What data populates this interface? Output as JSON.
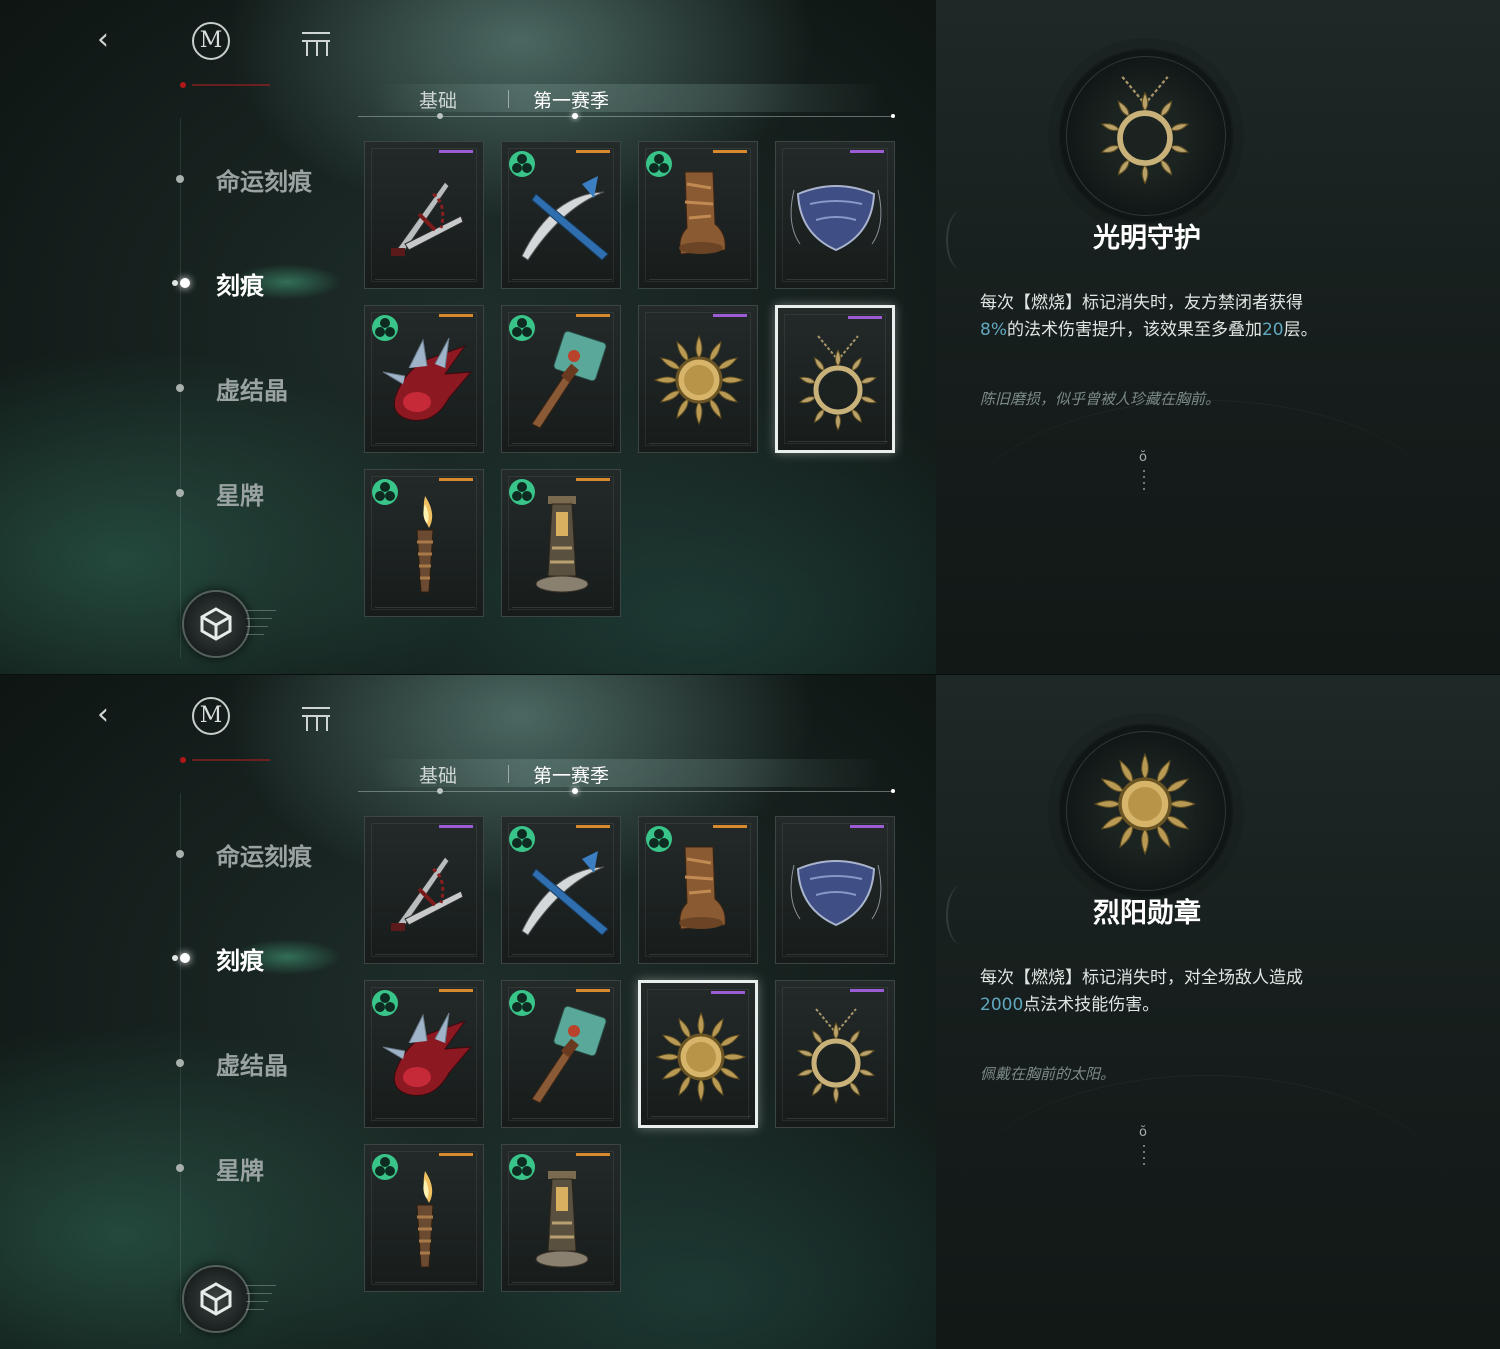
{
  "screens": [
    {
      "nav": {
        "back_icon": "chevron-left-icon",
        "logo": "M",
        "menu_icon": "menu-icon",
        "cube_icon": "cube-icon"
      },
      "sidebar": {
        "items": [
          {
            "label": "命运刻痕",
            "active": false
          },
          {
            "label": "刻痕",
            "active": true
          },
          {
            "label": "虚结晶",
            "active": false
          },
          {
            "label": "星牌",
            "active": false
          }
        ]
      },
      "tabs": [
        {
          "label": "基础",
          "active": false
        },
        {
          "label": "第一赛季",
          "active": true
        }
      ],
      "cards": [
        {
          "item": "twin-blades",
          "rarity": "purple",
          "badge": false,
          "selected": false
        },
        {
          "item": "crossed-blades",
          "rarity": "orange",
          "badge": true,
          "selected": false
        },
        {
          "item": "wooden-boot",
          "rarity": "orange",
          "badge": true,
          "selected": false
        },
        {
          "item": "silver-mask",
          "rarity": "purple",
          "badge": false,
          "selected": false
        },
        {
          "item": "red-crystal",
          "rarity": "orange",
          "badge": true,
          "selected": false
        },
        {
          "item": "stone-hammer",
          "rarity": "orange",
          "badge": true,
          "selected": false
        },
        {
          "item": "sun-medal",
          "rarity": "purple",
          "badge": false,
          "selected": false
        },
        {
          "item": "sun-necklace",
          "rarity": "purple",
          "badge": false,
          "selected": true
        },
        {
          "item": "torch",
          "rarity": "orange",
          "badge": true,
          "selected": false
        },
        {
          "item": "lantern-pillar",
          "rarity": "orange",
          "badge": true,
          "selected": false
        }
      ],
      "detail": {
        "item": "sun-necklace",
        "title": "光明守护",
        "desc": [
          {
            "text": "每次【燃烧】标记消失时，友方禁闭者获得",
            "hl": false
          },
          {
            "text": "8%",
            "hl": true
          },
          {
            "text": "的法术伤害提升，该效果至多叠加",
            "hl": false
          },
          {
            "text": "20",
            "hl": true
          },
          {
            "text": "层。",
            "hl": false
          }
        ],
        "flavor": "陈旧磨损，似乎曾被人珍藏在胸前。"
      }
    },
    {
      "nav": {
        "back_icon": "chevron-left-icon",
        "logo": "M",
        "menu_icon": "menu-icon",
        "cube_icon": "cube-icon"
      },
      "sidebar": {
        "items": [
          {
            "label": "命运刻痕",
            "active": false
          },
          {
            "label": "刻痕",
            "active": true
          },
          {
            "label": "虚结晶",
            "active": false
          },
          {
            "label": "星牌",
            "active": false
          }
        ]
      },
      "tabs": [
        {
          "label": "基础",
          "active": false
        },
        {
          "label": "第一赛季",
          "active": true
        }
      ],
      "cards": [
        {
          "item": "twin-blades",
          "rarity": "purple",
          "badge": false,
          "selected": false
        },
        {
          "item": "crossed-blades",
          "rarity": "orange",
          "badge": true,
          "selected": false
        },
        {
          "item": "wooden-boot",
          "rarity": "orange",
          "badge": true,
          "selected": false
        },
        {
          "item": "silver-mask",
          "rarity": "purple",
          "badge": false,
          "selected": false
        },
        {
          "item": "red-crystal",
          "rarity": "orange",
          "badge": true,
          "selected": false
        },
        {
          "item": "stone-hammer",
          "rarity": "orange",
          "badge": true,
          "selected": false
        },
        {
          "item": "sun-medal",
          "rarity": "purple",
          "badge": false,
          "selected": true
        },
        {
          "item": "sun-necklace",
          "rarity": "purple",
          "badge": false,
          "selected": false
        },
        {
          "item": "torch",
          "rarity": "orange",
          "badge": true,
          "selected": false
        },
        {
          "item": "lantern-pillar",
          "rarity": "orange",
          "badge": true,
          "selected": false
        }
      ],
      "detail": {
        "item": "sun-medal",
        "title": "烈阳勋章",
        "desc": [
          {
            "text": "每次【燃烧】标记消失时，对全场敌人造成",
            "hl": false
          },
          {
            "text": "2000",
            "hl": true
          },
          {
            "text": "点法术技能伤害。",
            "hl": false
          }
        ],
        "flavor": "佩戴在胸前的太阳。"
      }
    }
  ],
  "colors": {
    "highlight": "#5fa8bf",
    "badge": "#39c48a",
    "rarity_purple": "#9b5cd4",
    "rarity_orange": "#d68a2c"
  }
}
